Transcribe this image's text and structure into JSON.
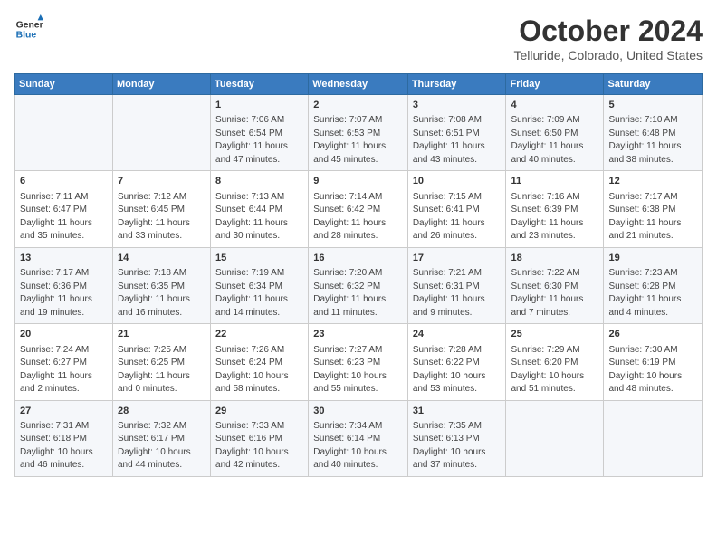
{
  "logo": {
    "line1": "General",
    "line2": "Blue"
  },
  "title": "October 2024",
  "subtitle": "Telluride, Colorado, United States",
  "weekdays": [
    "Sunday",
    "Monday",
    "Tuesday",
    "Wednesday",
    "Thursday",
    "Friday",
    "Saturday"
  ],
  "weeks": [
    [
      {
        "day": "",
        "sunrise": "",
        "sunset": "",
        "daylight": ""
      },
      {
        "day": "",
        "sunrise": "",
        "sunset": "",
        "daylight": ""
      },
      {
        "day": "1",
        "sunrise": "Sunrise: 7:06 AM",
        "sunset": "Sunset: 6:54 PM",
        "daylight": "Daylight: 11 hours and 47 minutes."
      },
      {
        "day": "2",
        "sunrise": "Sunrise: 7:07 AM",
        "sunset": "Sunset: 6:53 PM",
        "daylight": "Daylight: 11 hours and 45 minutes."
      },
      {
        "day": "3",
        "sunrise": "Sunrise: 7:08 AM",
        "sunset": "Sunset: 6:51 PM",
        "daylight": "Daylight: 11 hours and 43 minutes."
      },
      {
        "day": "4",
        "sunrise": "Sunrise: 7:09 AM",
        "sunset": "Sunset: 6:50 PM",
        "daylight": "Daylight: 11 hours and 40 minutes."
      },
      {
        "day": "5",
        "sunrise": "Sunrise: 7:10 AM",
        "sunset": "Sunset: 6:48 PM",
        "daylight": "Daylight: 11 hours and 38 minutes."
      }
    ],
    [
      {
        "day": "6",
        "sunrise": "Sunrise: 7:11 AM",
        "sunset": "Sunset: 6:47 PM",
        "daylight": "Daylight: 11 hours and 35 minutes."
      },
      {
        "day": "7",
        "sunrise": "Sunrise: 7:12 AM",
        "sunset": "Sunset: 6:45 PM",
        "daylight": "Daylight: 11 hours and 33 minutes."
      },
      {
        "day": "8",
        "sunrise": "Sunrise: 7:13 AM",
        "sunset": "Sunset: 6:44 PM",
        "daylight": "Daylight: 11 hours and 30 minutes."
      },
      {
        "day": "9",
        "sunrise": "Sunrise: 7:14 AM",
        "sunset": "Sunset: 6:42 PM",
        "daylight": "Daylight: 11 hours and 28 minutes."
      },
      {
        "day": "10",
        "sunrise": "Sunrise: 7:15 AM",
        "sunset": "Sunset: 6:41 PM",
        "daylight": "Daylight: 11 hours and 26 minutes."
      },
      {
        "day": "11",
        "sunrise": "Sunrise: 7:16 AM",
        "sunset": "Sunset: 6:39 PM",
        "daylight": "Daylight: 11 hours and 23 minutes."
      },
      {
        "day": "12",
        "sunrise": "Sunrise: 7:17 AM",
        "sunset": "Sunset: 6:38 PM",
        "daylight": "Daylight: 11 hours and 21 minutes."
      }
    ],
    [
      {
        "day": "13",
        "sunrise": "Sunrise: 7:17 AM",
        "sunset": "Sunset: 6:36 PM",
        "daylight": "Daylight: 11 hours and 19 minutes."
      },
      {
        "day": "14",
        "sunrise": "Sunrise: 7:18 AM",
        "sunset": "Sunset: 6:35 PM",
        "daylight": "Daylight: 11 hours and 16 minutes."
      },
      {
        "day": "15",
        "sunrise": "Sunrise: 7:19 AM",
        "sunset": "Sunset: 6:34 PM",
        "daylight": "Daylight: 11 hours and 14 minutes."
      },
      {
        "day": "16",
        "sunrise": "Sunrise: 7:20 AM",
        "sunset": "Sunset: 6:32 PM",
        "daylight": "Daylight: 11 hours and 11 minutes."
      },
      {
        "day": "17",
        "sunrise": "Sunrise: 7:21 AM",
        "sunset": "Sunset: 6:31 PM",
        "daylight": "Daylight: 11 hours and 9 minutes."
      },
      {
        "day": "18",
        "sunrise": "Sunrise: 7:22 AM",
        "sunset": "Sunset: 6:30 PM",
        "daylight": "Daylight: 11 hours and 7 minutes."
      },
      {
        "day": "19",
        "sunrise": "Sunrise: 7:23 AM",
        "sunset": "Sunset: 6:28 PM",
        "daylight": "Daylight: 11 hours and 4 minutes."
      }
    ],
    [
      {
        "day": "20",
        "sunrise": "Sunrise: 7:24 AM",
        "sunset": "Sunset: 6:27 PM",
        "daylight": "Daylight: 11 hours and 2 minutes."
      },
      {
        "day": "21",
        "sunrise": "Sunrise: 7:25 AM",
        "sunset": "Sunset: 6:25 PM",
        "daylight": "Daylight: 11 hours and 0 minutes."
      },
      {
        "day": "22",
        "sunrise": "Sunrise: 7:26 AM",
        "sunset": "Sunset: 6:24 PM",
        "daylight": "Daylight: 10 hours and 58 minutes."
      },
      {
        "day": "23",
        "sunrise": "Sunrise: 7:27 AM",
        "sunset": "Sunset: 6:23 PM",
        "daylight": "Daylight: 10 hours and 55 minutes."
      },
      {
        "day": "24",
        "sunrise": "Sunrise: 7:28 AM",
        "sunset": "Sunset: 6:22 PM",
        "daylight": "Daylight: 10 hours and 53 minutes."
      },
      {
        "day": "25",
        "sunrise": "Sunrise: 7:29 AM",
        "sunset": "Sunset: 6:20 PM",
        "daylight": "Daylight: 10 hours and 51 minutes."
      },
      {
        "day": "26",
        "sunrise": "Sunrise: 7:30 AM",
        "sunset": "Sunset: 6:19 PM",
        "daylight": "Daylight: 10 hours and 48 minutes."
      }
    ],
    [
      {
        "day": "27",
        "sunrise": "Sunrise: 7:31 AM",
        "sunset": "Sunset: 6:18 PM",
        "daylight": "Daylight: 10 hours and 46 minutes."
      },
      {
        "day": "28",
        "sunrise": "Sunrise: 7:32 AM",
        "sunset": "Sunset: 6:17 PM",
        "daylight": "Daylight: 10 hours and 44 minutes."
      },
      {
        "day": "29",
        "sunrise": "Sunrise: 7:33 AM",
        "sunset": "Sunset: 6:16 PM",
        "daylight": "Daylight: 10 hours and 42 minutes."
      },
      {
        "day": "30",
        "sunrise": "Sunrise: 7:34 AM",
        "sunset": "Sunset: 6:14 PM",
        "daylight": "Daylight: 10 hours and 40 minutes."
      },
      {
        "day": "31",
        "sunrise": "Sunrise: 7:35 AM",
        "sunset": "Sunset: 6:13 PM",
        "daylight": "Daylight: 10 hours and 37 minutes."
      },
      {
        "day": "",
        "sunrise": "",
        "sunset": "",
        "daylight": ""
      },
      {
        "day": "",
        "sunrise": "",
        "sunset": "",
        "daylight": ""
      }
    ]
  ]
}
